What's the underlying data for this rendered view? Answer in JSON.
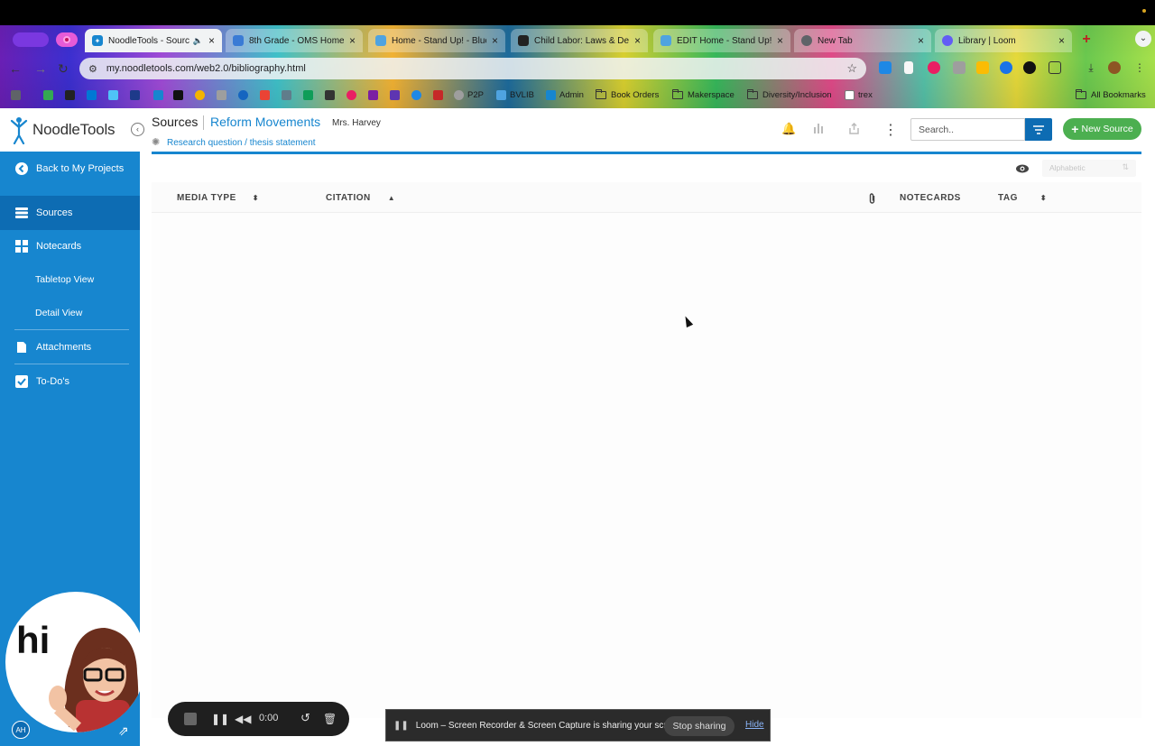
{
  "browser": {
    "tabs": [
      {
        "title": "NoodleTools - Source",
        "active": true,
        "favicon_color": "#1786cf"
      },
      {
        "title": "8th Grade - OMS Home",
        "active": false,
        "favicon_color": "#3a7bd5"
      },
      {
        "title": "Home - Stand Up! - Blue",
        "active": false,
        "favicon_color": "#4fa3e0"
      },
      {
        "title": "Child Labor: Laws & De",
        "active": false,
        "favicon_color": "#222222"
      },
      {
        "title": "EDIT Home - Stand Up!",
        "active": false,
        "favicon_color": "#4fa3e0"
      },
      {
        "title": "New Tab",
        "active": false,
        "favicon_color": "#5f6368"
      },
      {
        "title": "Library | Loom",
        "active": false,
        "favicon_color": "#625df5"
      }
    ],
    "url": "my.noodletools.com/web2.0/bibliography.html",
    "bookmarks": [
      {
        "label": "P2P",
        "type": "link"
      },
      {
        "label": "BVLIB",
        "type": "link"
      },
      {
        "label": "Admin",
        "type": "link"
      },
      {
        "label": "Book Orders",
        "type": "folder"
      },
      {
        "label": "Makerspace",
        "type": "folder"
      },
      {
        "label": "Diversity/Inclusion",
        "type": "folder"
      },
      {
        "label": "trex",
        "type": "link"
      }
    ],
    "all_bookmarks": "All Bookmarks"
  },
  "app": {
    "logo": "NoodleTools",
    "sidebar": {
      "back": "Back to My Projects",
      "items": [
        {
          "label": "Sources",
          "icon": "stack-icon",
          "active": true
        },
        {
          "label": "Notecards",
          "icon": "grid-icon",
          "active": false
        },
        {
          "label": "Tabletop View",
          "sub": true
        },
        {
          "label": "Detail View",
          "sub": true
        },
        {
          "label": "Attachments",
          "icon": "attachment-icon",
          "active": false
        },
        {
          "label": "To-Do's",
          "icon": "checkbox-icon",
          "active": false
        }
      ]
    },
    "header": {
      "section": "Sources",
      "project": "Reform Movements",
      "teacher": "Mrs. Harvey",
      "research_link": "Research question / thesis statement"
    },
    "search": {
      "placeholder": "Search.."
    },
    "new_source": "New Source",
    "sort": {
      "selected": "Alphabetic"
    },
    "table": {
      "columns": [
        "MEDIA TYPE",
        "CITATION",
        "NOTECARDS",
        "TAG"
      ],
      "rows": []
    },
    "colors": {
      "accent": "#1786cf",
      "dark_accent": "#0d6cb3",
      "success": "#4caf50"
    }
  },
  "loom": {
    "timer": "0:00",
    "bitmoji_text": "hi",
    "user_initials": "AH",
    "share_message": "Loom – Screen Recorder & Screen Capture is sharing your screen.",
    "stop_sharing": "Stop sharing",
    "hide": "Hide"
  }
}
